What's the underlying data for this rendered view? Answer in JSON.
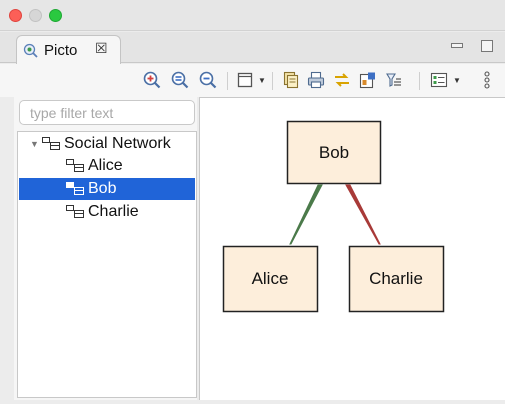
{
  "window": {
    "controls": {
      "close": "close",
      "minimize": "minimize",
      "zoom": "zoom"
    }
  },
  "view": {
    "tab_title": "Picto",
    "tab_close_glyph": "☒",
    "tab_icon": "picto-icon"
  },
  "toolbar": {
    "buttons": [
      "zoom-in-icon",
      "zoom-reset-icon",
      "zoom-out-icon",
      "layout-icon",
      "copy-icon",
      "print-icon",
      "sync-icon",
      "export-icon",
      "filter-icon",
      "options-icon",
      "more-icon"
    ]
  },
  "filter": {
    "placeholder": "type filter text",
    "value": ""
  },
  "tree": {
    "root": "Social Network",
    "children": [
      "Alice",
      "Bob",
      "Charlie"
    ],
    "selected": "Bob"
  },
  "diagram": {
    "nodes": [
      "Bob",
      "Alice",
      "Charlie"
    ],
    "edges": [
      {
        "from": "Bob",
        "to": "Alice",
        "color": "#4b7a4a"
      },
      {
        "from": "Bob",
        "to": "Charlie",
        "color": "#a83a38"
      }
    ],
    "box_fill": "#fdeedb",
    "box_stroke": "#222222"
  },
  "colors": {
    "selection": "#2064d8",
    "chrome": "#ececec"
  }
}
